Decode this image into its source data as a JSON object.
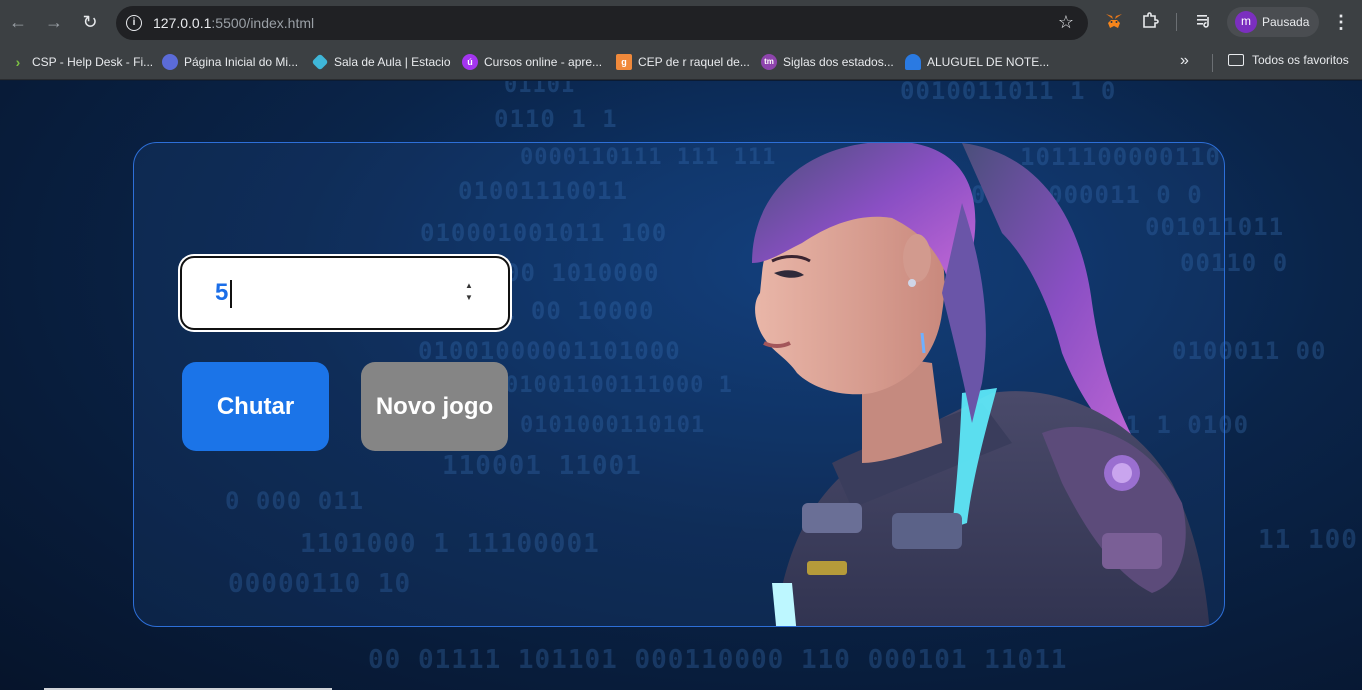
{
  "browser": {
    "url_host": "127.0.0.1",
    "url_path": ":5500/index.html",
    "profile_initial": "m",
    "profile_name": "Pausada",
    "bookmarks": [
      {
        "label": "CSP - Help Desk - Fi...",
        "icon": "chevron-icon",
        "color": "#7cc242"
      },
      {
        "label": "Página Inicial do Mi...",
        "icon": "hexagon-icon",
        "color": "#5b6bd8"
      },
      {
        "label": "Sala de Aula | Estacio",
        "icon": "diamond-icon",
        "color": "#3fb6d8"
      },
      {
        "label": "Cursos online - apre...",
        "icon": "udemy-icon",
        "color": "#a435f0"
      },
      {
        "label": "CEP de r raquel de...",
        "icon": "g-plus-icon",
        "color": "#f0893b"
      },
      {
        "label": "Siglas dos estados...",
        "icon": "tm-icon",
        "color": "#8e44ad"
      },
      {
        "label": "ALUGUEL DE NOTE...",
        "icon": "person-icon",
        "color": "#2a7ae2"
      }
    ],
    "all_bookmarks_label": "Todos os favoritos"
  },
  "game": {
    "guess_value": "5",
    "chutar_label": "Chutar",
    "novo_jogo_label": "Novo jogo"
  },
  "background_binary": [
    "01101",
    "0110 1 1",
    "0000110111 111 111",
    "01001110011",
    "00111101 11 1 10",
    "010001001011 100",
    "10111101 1 0",
    "00 1010000",
    "1 00 10000",
    "01001000001101000",
    "01001100111000 1",
    "0101000110101",
    "110001 11001",
    "0 000 011",
    "1101000 1 11100001",
    "00000110 10",
    "00 01111 101101 000110000 110 000101 11011",
    "0010011011 1 0",
    "1011100000110",
    "0000110000011 0 0",
    "001011011",
    "00110 0",
    "0100011 00",
    "11 100",
    "11 1 0100"
  ],
  "colors": {
    "primary_button": "#1b74e8",
    "secondary_button": "#858585",
    "card_border": "#2d6fd8",
    "input_value": "#1b6ee8"
  }
}
